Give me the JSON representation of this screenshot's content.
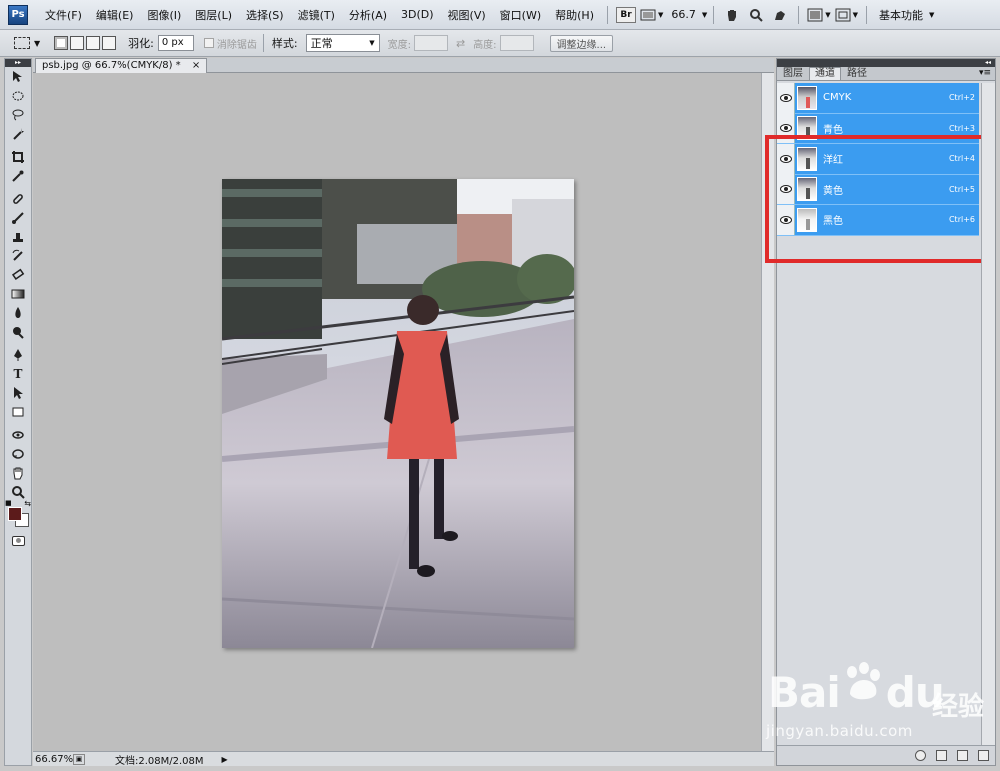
{
  "app": {
    "logo": "Ps"
  },
  "menu": [
    "文件(F)",
    "编辑(E)",
    "图像(I)",
    "图层(L)",
    "选择(S)",
    "滤镜(T)",
    "分析(A)",
    "3D(D)",
    "视图(V)",
    "窗口(W)",
    "帮助(H)"
  ],
  "menubar": {
    "bridge": "Br",
    "zoom": "66.7",
    "workspace": "基本功能"
  },
  "options": {
    "feather_label": "羽化:",
    "feather_value": "0 px",
    "antialias_label": "消除锯齿",
    "style_label": "样式:",
    "style_value": "正常",
    "width_label": "宽度:",
    "height_label": "高度:",
    "refine_label": "调整边缘..."
  },
  "document": {
    "tab_title": "psb.jpg @ 66.7%(CMYK/8) *",
    "close": "×"
  },
  "status": {
    "zoom": "66.67%",
    "doc_info": "文档:2.08M/2.08M"
  },
  "panel": {
    "tabs": [
      "图层",
      "通道",
      "路径"
    ],
    "active_tab": "通道",
    "channels": [
      {
        "name": "CMYK",
        "shortcut": "Ctrl+2"
      },
      {
        "name": "青色",
        "shortcut": "Ctrl+3"
      },
      {
        "name": "洋红",
        "shortcut": "Ctrl+4"
      },
      {
        "name": "黄色",
        "shortcut": "Ctrl+5"
      },
      {
        "name": "黑色",
        "shortcut": "Ctrl+6"
      }
    ]
  },
  "watermark": {
    "brand": "Bai",
    "brand2": "du",
    "zh": "经验",
    "url": "jingyan.baidu.com"
  },
  "colors": {
    "foreground": "#5c1b1b",
    "background": "#ffffff",
    "selection": "#3b9cf0",
    "highlight": "#e02a2a"
  }
}
